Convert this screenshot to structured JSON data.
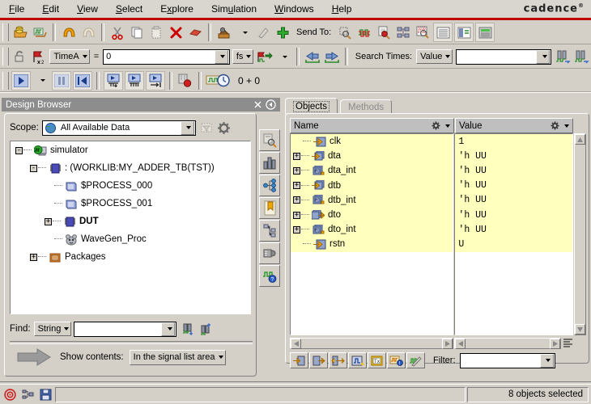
{
  "app": {
    "brand": "cadence",
    "brand_tm": "®"
  },
  "menubar": {
    "items": [
      {
        "label": "File",
        "accel": "F"
      },
      {
        "label": "Edit",
        "accel": "E"
      },
      {
        "label": "View",
        "accel": "V"
      },
      {
        "label": "Select",
        "accel": "S"
      },
      {
        "label": "Explore",
        "accel": "x"
      },
      {
        "label": "Simulation",
        "accel": "u"
      },
      {
        "label": "Windows",
        "accel": "W"
      },
      {
        "label": "Help",
        "accel": "H"
      }
    ]
  },
  "toolbar1": {
    "buttons": [
      {
        "name": "open-database-icon"
      },
      {
        "name": "open-waveform-icon"
      },
      {
        "name": "undo-icon"
      },
      {
        "name": "redo-icon"
      },
      {
        "name": "cut-icon"
      },
      {
        "name": "copy-icon"
      },
      {
        "name": "paste-icon"
      },
      {
        "name": "delete-icon"
      },
      {
        "name": "erase-icon"
      },
      {
        "name": "probe-icon"
      },
      {
        "name": "create-probe-icon"
      },
      {
        "name": "add-icon"
      }
    ],
    "send_to_label": "Send To:",
    "send_to_buttons": [
      {
        "name": "send-to-schematic-icon"
      },
      {
        "name": "send-to-waveform-icon"
      },
      {
        "name": "send-to-source-browser-icon"
      },
      {
        "name": "send-to-design-browser-icon"
      },
      {
        "name": "send-to-register-icon"
      },
      {
        "name": "send-to-list-icon"
      },
      {
        "name": "send-to-watch-icon"
      },
      {
        "name": "send-to-memory-icon"
      }
    ]
  },
  "toolbar2": {
    "lock_icon": "lock-icon",
    "marker_icon": "marker-x2-icon",
    "time_marker": "TimeA",
    "equals": "=",
    "time_value": "0",
    "time_unit": "fs",
    "goto_marker_icon": "goto-marker-icon",
    "prev_icon": "previous-edge-icon",
    "next_icon": "next-edge-icon",
    "search_label": "Search Times:",
    "search_mode": "Value",
    "search_value": "",
    "search_prev_icon": "search-backward-icon",
    "search_next_icon": "search-forward-icon"
  },
  "toolbar3": {
    "run_icon": "run-icon",
    "run_menu_icon": "run-menu-caret",
    "pause_icon": "pause-icon",
    "reset_icon": "restart-icon",
    "step_in_icon": "step-into-icon",
    "step_over_icon": "step-over-icon",
    "step_out_icon": "step-out-icon",
    "stop_icon": "stop-icon",
    "time_icon": "sim-time-icon",
    "sim_time": "0 + 0"
  },
  "design_browser": {
    "title": "Design Browser",
    "close_icon": "close-icon",
    "collapse_icon": "collapse-panel-icon",
    "scope": {
      "label": "Scope:",
      "icon": "globe-icon",
      "value": "All Available Data",
      "filter_icon": "scope-filter-icon",
      "settings_icon": "gear-icon",
      "browse_icon": "browse-scope-icon"
    },
    "tree": [
      {
        "indent": 0,
        "expander": "-",
        "icon": "simulator-icon",
        "label": "simulator",
        "bold": false
      },
      {
        "indent": 1,
        "expander": "-",
        "icon": "module-icon",
        "label": ": (WORKLIB:MY_ADDER_TB(TST))",
        "bold": false
      },
      {
        "indent": 2,
        "expander": "",
        "icon": "process-icon",
        "label": "$PROCESS_000",
        "bold": false
      },
      {
        "indent": 2,
        "expander": "",
        "icon": "process-icon",
        "label": "$PROCESS_001",
        "bold": false
      },
      {
        "indent": 2,
        "expander": "+",
        "icon": "module-icon",
        "label": "DUT",
        "bold": true
      },
      {
        "indent": 2,
        "expander": "",
        "icon": "wavegen-icon",
        "label": "WaveGen_Proc",
        "bold": false
      },
      {
        "indent": 1,
        "expander": "+",
        "icon": "package-icon",
        "label": "Packages",
        "bold": false
      }
    ],
    "find": {
      "label": "Find:",
      "mode": "String",
      "value": "",
      "find_down_icon": "find-next-icon",
      "find_up_icon": "find-previous-icon"
    },
    "show_contents": {
      "arrow_icon": "big-arrow-icon",
      "label": "Show contents:",
      "value": "In the signal list area"
    },
    "side_tools": [
      {
        "name": "browse-scope-icon"
      },
      {
        "name": "hierarchy-icon"
      },
      {
        "name": "signal-tree-icon"
      },
      {
        "name": "bookmark-icon"
      },
      {
        "name": "schematic-tree-icon"
      },
      {
        "name": "memory-view-icon"
      },
      {
        "name": "waveform-help-icon"
      }
    ]
  },
  "objects_panel": {
    "tabs": [
      {
        "label": "Objects",
        "selected": true
      },
      {
        "label": "Methods",
        "selected": false
      }
    ],
    "columns": [
      {
        "label": "Name",
        "gear_icon": "gear-icon"
      },
      {
        "label": "Value",
        "gear_icon": "gear-icon"
      }
    ],
    "rows": [
      {
        "expander": "",
        "icon": "signal-in-icon",
        "name": "clk",
        "value": "1"
      },
      {
        "expander": "+",
        "icon": "signal-bus-in-icon",
        "name": "dta",
        "value": "'h UU"
      },
      {
        "expander": "+",
        "icon": "signal-bus-int-icon",
        "name": "dta_int",
        "value": "'h UU"
      },
      {
        "expander": "+",
        "icon": "signal-bus-in-icon",
        "name": "dtb",
        "value": "'h UU"
      },
      {
        "expander": "+",
        "icon": "signal-bus-int-icon",
        "name": "dtb_int",
        "value": "'h UU"
      },
      {
        "expander": "+",
        "icon": "signal-bus-out-icon",
        "name": "dto",
        "value": "'h UU"
      },
      {
        "expander": "+",
        "icon": "signal-bus-int-icon",
        "name": "dto_int",
        "value": "'h UU"
      },
      {
        "expander": "",
        "icon": "signal-in-icon",
        "name": "rstn",
        "value": "U"
      }
    ],
    "bottom_tools": [
      {
        "name": "send-to-waveform-icon"
      },
      {
        "name": "send-to-right-icon"
      },
      {
        "name": "send-both-icon"
      },
      {
        "name": "waveform-window-icon"
      },
      {
        "name": "transaction-icon"
      },
      {
        "name": "register-watch-icon"
      },
      {
        "name": "schematic-probe-icon"
      }
    ],
    "filter": {
      "label": "Filter:",
      "value": ""
    },
    "list_options_icon": "list-options-icon",
    "scroll_up_icon": "scroll-up-arrow",
    "scroll_down_icon": "scroll-down-arrow",
    "scroll_left_icon": "scroll-left-arrow",
    "scroll_right_icon": "scroll-right-arrow"
  },
  "statusbar": {
    "buttons": [
      {
        "name": "target-icon"
      },
      {
        "name": "reconnect-icon"
      },
      {
        "name": "save-icon"
      }
    ],
    "message": "",
    "selection": "8 objects selected"
  },
  "colors": {
    "brand_red": "#c00000",
    "panel_bg": "#d4d0c8",
    "title_bg": "#8d8d8d",
    "row_highlight": "#ffffbe",
    "accent_yellow": "#f5a623"
  }
}
